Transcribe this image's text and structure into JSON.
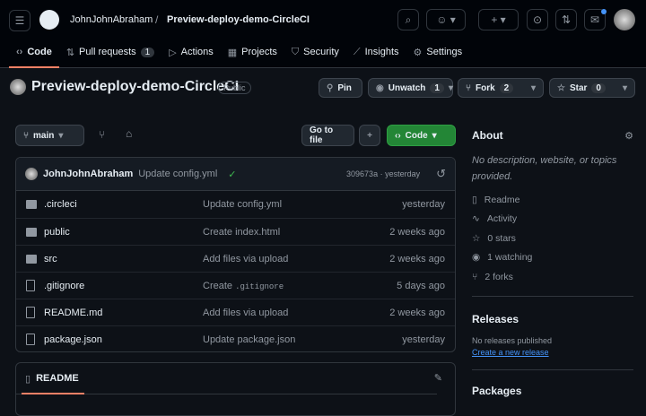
{
  "header": {
    "owner": "JohnJohnAbraham",
    "sep": "/",
    "repo": "Preview-deploy-demo-CircleCI"
  },
  "tabs": [
    {
      "label": "Code",
      "icon": "code-icon"
    },
    {
      "label": "Pull requests",
      "count": "1",
      "icon": "pull-request-icon"
    },
    {
      "label": "Actions",
      "icon": "play-icon"
    },
    {
      "label": "Projects",
      "icon": "table-icon"
    },
    {
      "label": "Security",
      "icon": "shield-icon"
    },
    {
      "label": "Insights",
      "icon": "graph-icon"
    },
    {
      "label": "Settings",
      "icon": "gear-icon"
    }
  ],
  "repo": {
    "title": "Preview-deploy-demo-CircleCI",
    "visibility": "Public",
    "pin": "Pin",
    "unwatch": "Unwatch",
    "watch_count": "1",
    "fork": "Fork",
    "fork_count": "2",
    "star": "Star",
    "star_count": "0"
  },
  "toolbar": {
    "branch": "main",
    "goto": "Go to file",
    "add": "+",
    "code": "Code"
  },
  "commit": {
    "author": "JohnJohnAbraham",
    "message": "Update config.yml",
    "hash_time": "309673a · yesterday"
  },
  "files": [
    {
      "name": ".circleci",
      "type": "folder",
      "message": "Update config.yml",
      "date": "yesterday"
    },
    {
      "name": "public",
      "type": "folder",
      "message": "Create index.html",
      "date": "2 weeks ago"
    },
    {
      "name": "src",
      "type": "folder",
      "message": "Add files via upload",
      "date": "2 weeks ago"
    },
    {
      "name": ".gitignore",
      "type": "file",
      "message": "Create",
      "message_code": ".gitignore",
      "date": "5 days ago"
    },
    {
      "name": "README.md",
      "type": "file",
      "message": "Add files via upload",
      "date": "2 weeks ago"
    },
    {
      "name": "package.json",
      "type": "file",
      "message": "Update package.json",
      "date": "yesterday"
    }
  ],
  "readme": {
    "tab": "README"
  },
  "about": {
    "title": "About",
    "description": "No description, website, or topics provided.",
    "items": [
      "Readme",
      "Activity",
      "0 stars",
      "1 watching",
      "2 forks"
    ]
  },
  "releases": {
    "title": "Releases",
    "none": "No releases published",
    "create": "Create a new release"
  },
  "packages": {
    "title": "Packages"
  }
}
